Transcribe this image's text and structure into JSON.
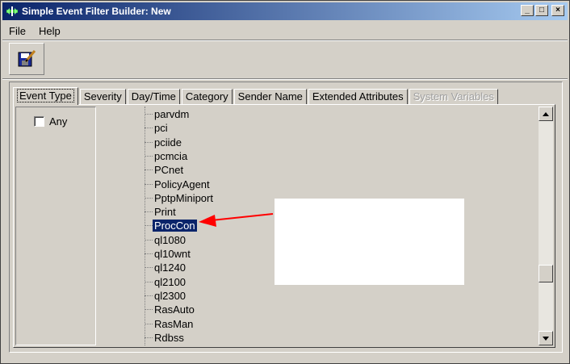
{
  "window": {
    "title": "Simple Event Filter Builder: New",
    "buttons": {
      "minimize": "_",
      "maximize": "□",
      "close": "×"
    }
  },
  "menu": {
    "items": [
      "File",
      "Help"
    ]
  },
  "toolbar": {
    "icon": "save-edit-icon"
  },
  "tabs": [
    {
      "label": "Event Type",
      "active": true
    },
    {
      "label": "Severity"
    },
    {
      "label": "Day/Time"
    },
    {
      "label": "Category"
    },
    {
      "label": "Sender Name"
    },
    {
      "label": "Extended Attributes"
    },
    {
      "label": "System Variables",
      "disabled": true
    }
  ],
  "filter": {
    "any_label": "Any",
    "any_checked": false
  },
  "tree": {
    "items": [
      "parvdm",
      "pci",
      "pciide",
      "pcmcia",
      "PCnet",
      "PolicyAgent",
      "PptpMiniport",
      "Print",
      "ProcCon",
      "ql1080",
      "ql10wnt",
      "ql1240",
      "ql2100",
      "ql2300",
      "RasAuto",
      "RasMan",
      "Rdbss"
    ],
    "selected": "ProcCon"
  },
  "colors": {
    "title_start": "#0a246a",
    "title_end": "#a6caf0",
    "selection": "#0a246a",
    "arrow": "#ff0000"
  }
}
